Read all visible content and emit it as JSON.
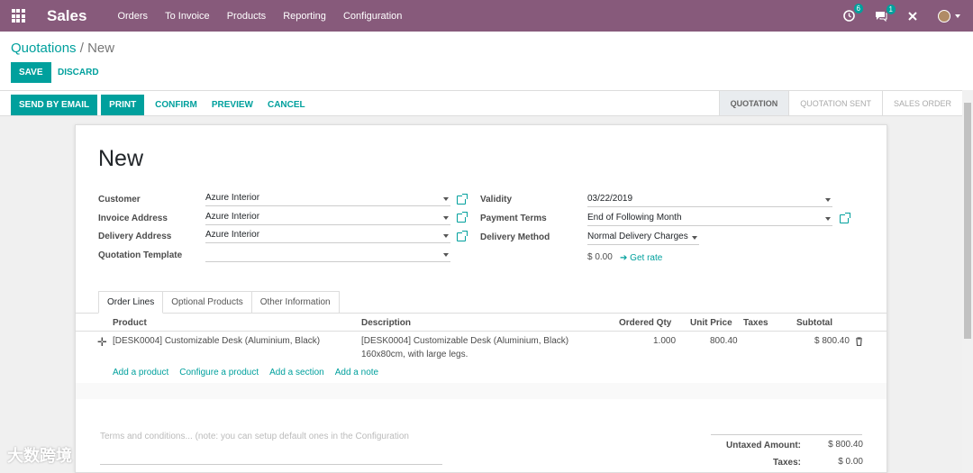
{
  "navbar": {
    "brand": "Sales",
    "menu": [
      "Orders",
      "To Invoice",
      "Products",
      "Reporting",
      "Configuration"
    ],
    "activities_count": "6",
    "messages_count": "1",
    "colors": {
      "bar": "#875a7b",
      "accent": "#00a09d"
    }
  },
  "control_panel": {
    "breadcrumb_parent": "Quotations",
    "breadcrumb_sep": "/",
    "breadcrumb_current": "New",
    "save_label": "SAVE",
    "discard_label": "DISCARD"
  },
  "statusbar": {
    "send_email": "SEND BY EMAIL",
    "print": "PRINT",
    "confirm": "CONFIRM",
    "preview": "PREVIEW",
    "cancel": "CANCEL",
    "stages": [
      "QUOTATION",
      "QUOTATION SENT",
      "SALES ORDER"
    ]
  },
  "form": {
    "title": "New",
    "customer_label": "Customer",
    "customer_value": "Azure Interior",
    "invoice_address_label": "Invoice Address",
    "invoice_address_value": "Azure Interior",
    "delivery_address_label": "Delivery Address",
    "delivery_address_value": "Azure Interior",
    "quotation_template_label": "Quotation Template",
    "quotation_template_value": "",
    "validity_label": "Validity",
    "validity_value": "03/22/2019",
    "payment_terms_label": "Payment Terms",
    "payment_terms_value": "End of Following Month",
    "delivery_method_label": "Delivery Method",
    "delivery_method_value": "Normal Delivery Charges",
    "delivery_price": "$ 0.00",
    "get_rate": "Get rate"
  },
  "tabs": [
    "Order Lines",
    "Optional Products",
    "Other Information"
  ],
  "order_lines": {
    "headers": {
      "product": "Product",
      "description": "Description",
      "ordered_qty": "Ordered Qty",
      "unit_price": "Unit Price",
      "taxes": "Taxes",
      "subtotal": "Subtotal"
    },
    "rows": [
      {
        "product": "[DESK0004] Customizable Desk (Aluminium, Black)",
        "description_line1": "[DESK0004] Customizable Desk (Aluminium, Black)",
        "description_line2": "160x80cm, with large legs.",
        "ordered_qty": "1.000",
        "unit_price": "800.40",
        "taxes": "",
        "subtotal": "$ 800.40"
      }
    ],
    "add_product": "Add a product",
    "configure_product": "Configure a product",
    "add_section": "Add a section",
    "add_note": "Add a note"
  },
  "terms_placeholder": "Terms and conditions... (note: you can setup default ones in the Configuration",
  "totals": {
    "untaxed_label": "Untaxed Amount:",
    "untaxed_value": "$ 800.40",
    "taxes_label": "Taxes:",
    "taxes_value": "$ 0.00"
  },
  "watermark": "大数跨境"
}
